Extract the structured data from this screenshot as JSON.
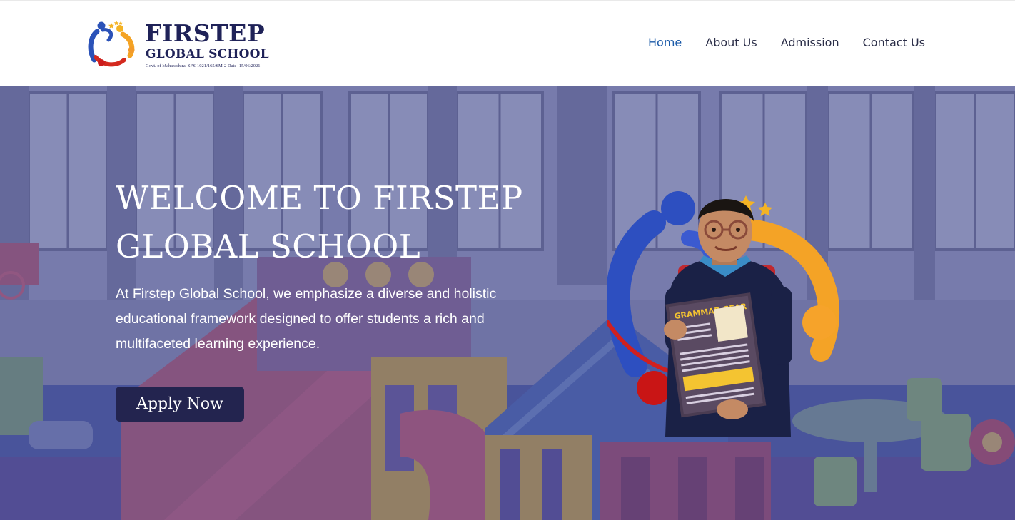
{
  "header": {
    "logo": {
      "name": "FIRSTEP",
      "subtitle": "GLOBAL SCHOOL",
      "registration": "Govt. of Maharashtra. SFS-1021/165/SM-2 Date -15/06/2021"
    },
    "nav": {
      "home": "Home",
      "about": "About Us",
      "admission": "Admission",
      "contact": "Contact Us",
      "active": "Home"
    }
  },
  "hero": {
    "title": "WELCOME TO FIRSTEP GLOBAL SCHOOL",
    "description": "At Firstep Global School, we emphasize a diverse and holistic educational framework designed to offer students a rich and multifaceted learning experience.",
    "cta_label": "Apply Now",
    "book_title": "GRAMMAR GEAR",
    "background": "classroom-play-area-photo",
    "foreground": "student-with-book-photo"
  },
  "colors": {
    "brand_navy": "#1f2258",
    "nav_active": "#1b5aa8",
    "nav_text": "#2b2e48",
    "button_bg": "#23244f",
    "overlay": "#484c8a"
  }
}
